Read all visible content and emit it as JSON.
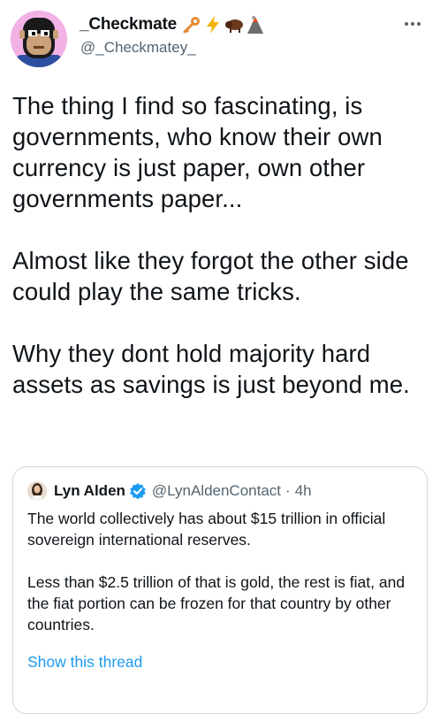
{
  "author": {
    "display_name": "_Checkmate",
    "handle": "@_Checkmatey_",
    "badges": [
      "key-emoji",
      "lightning-emoji",
      "bison-emoji",
      "volcano-emoji"
    ],
    "avatar": "ape-avatar"
  },
  "tweet": {
    "paragraphs": [
      "The thing I find so fascinating, is governments, who know their own currency is just paper, own other governments paper...",
      "Almost like they forgot the other side could play the same tricks.",
      "Why they dont hold majority hard assets as savings is just beyond me."
    ]
  },
  "quote": {
    "display_name": "Lyn Alden",
    "verified": true,
    "handle": "@LynAldenContact",
    "separator": "·",
    "time": "4h",
    "paragraphs": [
      "The world collectively has about $15 trillion in official sovereign international reserves.",
      "Less than $2.5 trillion of that is gold, the rest is fiat, and the fiat portion can be frozen for that country by other countries."
    ],
    "show_thread_label": "Show this thread"
  },
  "colors": {
    "text_primary": "#0f1419",
    "text_secondary": "#536471",
    "link": "#1d9bf0",
    "border": "#cfd9de",
    "avatar_bg": "#f2b2e6"
  }
}
